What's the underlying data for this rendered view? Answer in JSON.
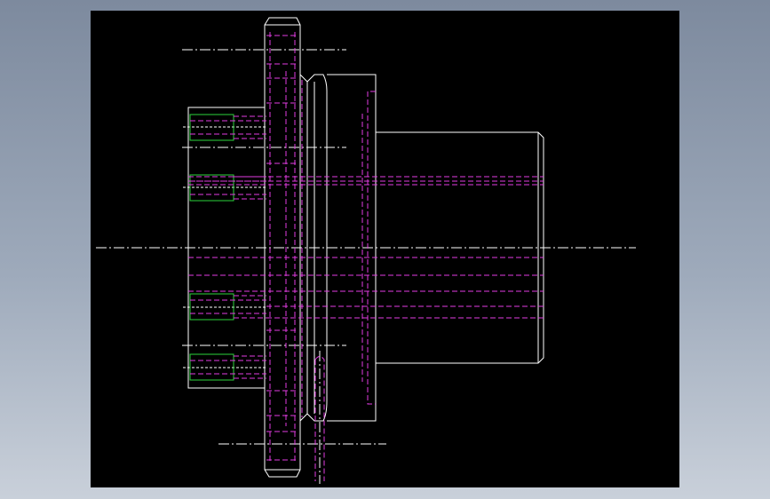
{
  "viewport": {
    "background": "#000000",
    "frame_background": "#8f9bb0"
  },
  "drawing": {
    "colors": {
      "visible_edge": "#ffffff",
      "hidden_edge": "#e23de2",
      "thread_edge": "#2bd43b",
      "center_line": "#ffffff"
    },
    "parts": [
      "flange",
      "hub",
      "shaft",
      "bolt-holes",
      "center-lines"
    ]
  }
}
